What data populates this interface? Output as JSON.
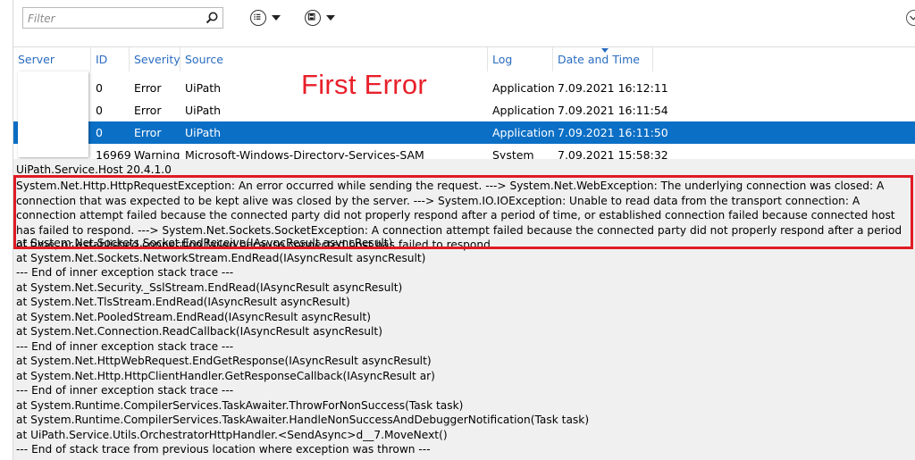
{
  "toolbar": {
    "filter_placeholder": "Filter",
    "search_icon": "search-icon",
    "list_icon": "list-options-icon",
    "save_icon": "save-icon",
    "collapse_icon": "chevron-down-icon"
  },
  "grid": {
    "columns": [
      "Server Name",
      "ID",
      "Severity",
      "Source",
      "Log",
      "Date and Time"
    ],
    "sorted_column": "Date and Time",
    "rows": [
      {
        "server": "",
        "id": "0",
        "severity": "Error",
        "source": "UiPath",
        "log": "Application",
        "datetime": "7.09.2021 16:12:11"
      },
      {
        "server": "",
        "id": "0",
        "severity": "Error",
        "source": "UiPath",
        "log": "Application",
        "datetime": "7.09.2021 16:11:54"
      },
      {
        "server": "",
        "id": "0",
        "severity": "Error",
        "source": "UiPath",
        "log": "Application",
        "datetime": "7.09.2021 16:11:50"
      },
      {
        "server": "",
        "id": "16969",
        "severity": "Warning",
        "source": "Microsoft-Windows-Directory-Services-SAM",
        "log": "System",
        "datetime": "7.09.2021 15:58:32"
      }
    ],
    "selected_row_index": 2,
    "annotation": "First Error"
  },
  "detail": {
    "title": "UiPath.Service.Host 20.4.1.0",
    "message": "System.Net.Http.HttpRequestException: An error occurred while sending the request. ---> System.Net.WebException: The underlying connection was closed: A connection that was expected to be kept alive was closed by the server. ---> System.IO.IOException: Unable to read data from the transport connection: A connection attempt failed because the connected party did not properly respond after a period of time, or established connection failed because connected host has failed to respond. ---> System.Net.Sockets.SocketException: A connection attempt failed because the connected party did not properly respond after a period of time, or established connection failed because connected host has failed to respond",
    "stack": [
      "   at System.Net.Sockets.Socket.EndReceive(IAsyncResult asyncResult)",
      "   at System.Net.Sockets.NetworkStream.EndRead(IAsyncResult asyncResult)",
      "   --- End of inner exception stack trace ---",
      "   at System.Net.Security._SslStream.EndRead(IAsyncResult asyncResult)",
      "   at System.Net.TlsStream.EndRead(IAsyncResult asyncResult)",
      "   at System.Net.PooledStream.EndRead(IAsyncResult asyncResult)",
      "   at System.Net.Connection.ReadCallback(IAsyncResult asyncResult)",
      "   --- End of inner exception stack trace ---",
      "   at System.Net.HttpWebRequest.EndGetResponse(IAsyncResult asyncResult)",
      "   at System.Net.Http.HttpClientHandler.GetResponseCallback(IAsyncResult ar)",
      "   --- End of inner exception stack trace ---",
      "   at System.Runtime.CompilerServices.TaskAwaiter.ThrowForNonSuccess(Task task)",
      "   at System.Runtime.CompilerServices.TaskAwaiter.HandleNonSuccessAndDebuggerNotification(Task task)",
      "   at UiPath.Service.Utils.OrchestratorHttpHandler.<SendAsync>d__7.MoveNext()",
      "--- End of stack trace from previous location where exception was thrown ---"
    ]
  },
  "colors": {
    "accent": "#2a6cc0",
    "selection": "#0b6fc5",
    "annotation": "#e8202a"
  }
}
